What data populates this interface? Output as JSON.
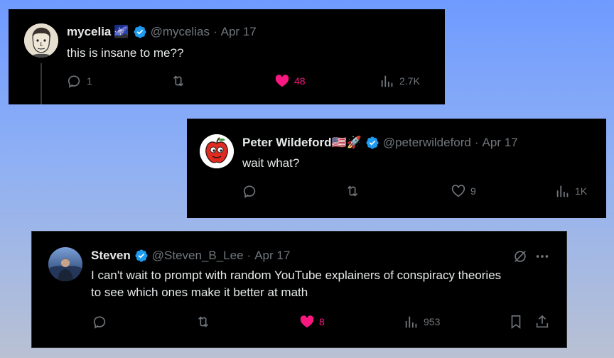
{
  "tweets": [
    {
      "display_name": "mycelia",
      "emoji": "🌌",
      "handle": "@mycelias",
      "dot": "·",
      "date": "Apr 17",
      "text": "this is insane to me??",
      "replies": "1",
      "retweets": "",
      "likes": "48",
      "liked": true,
      "views": "2.7K"
    },
    {
      "display_name": "Peter Wildeford",
      "emoji": "🇺🇸🚀",
      "handle": "@peterwildeford",
      "dot": "·",
      "date": "Apr 17",
      "text": "wait what?",
      "replies": "",
      "retweets": "",
      "likes": "9",
      "liked": false,
      "views": "1K"
    },
    {
      "display_name": "Steven",
      "handle": "@Steven_B_Lee",
      "dot": "·",
      "date": "Apr 17",
      "text_line1": "I can't wait to prompt with random YouTube explainers of conspiracy theories",
      "text_line2": "to see which ones make it better at math",
      "replies": "",
      "retweets": "",
      "likes": "8",
      "liked": true,
      "views": "953"
    }
  ],
  "colors": {
    "verified": "#1d9bf0",
    "like_active": "#f91880",
    "muted": "#71767b",
    "text": "#e7e9ea"
  },
  "icons": [
    "reply-icon",
    "retweet-icon",
    "like-icon",
    "views-icon",
    "bookmark-icon",
    "share-icon",
    "grok-icon",
    "more-icon",
    "verified-badge-icon"
  ]
}
